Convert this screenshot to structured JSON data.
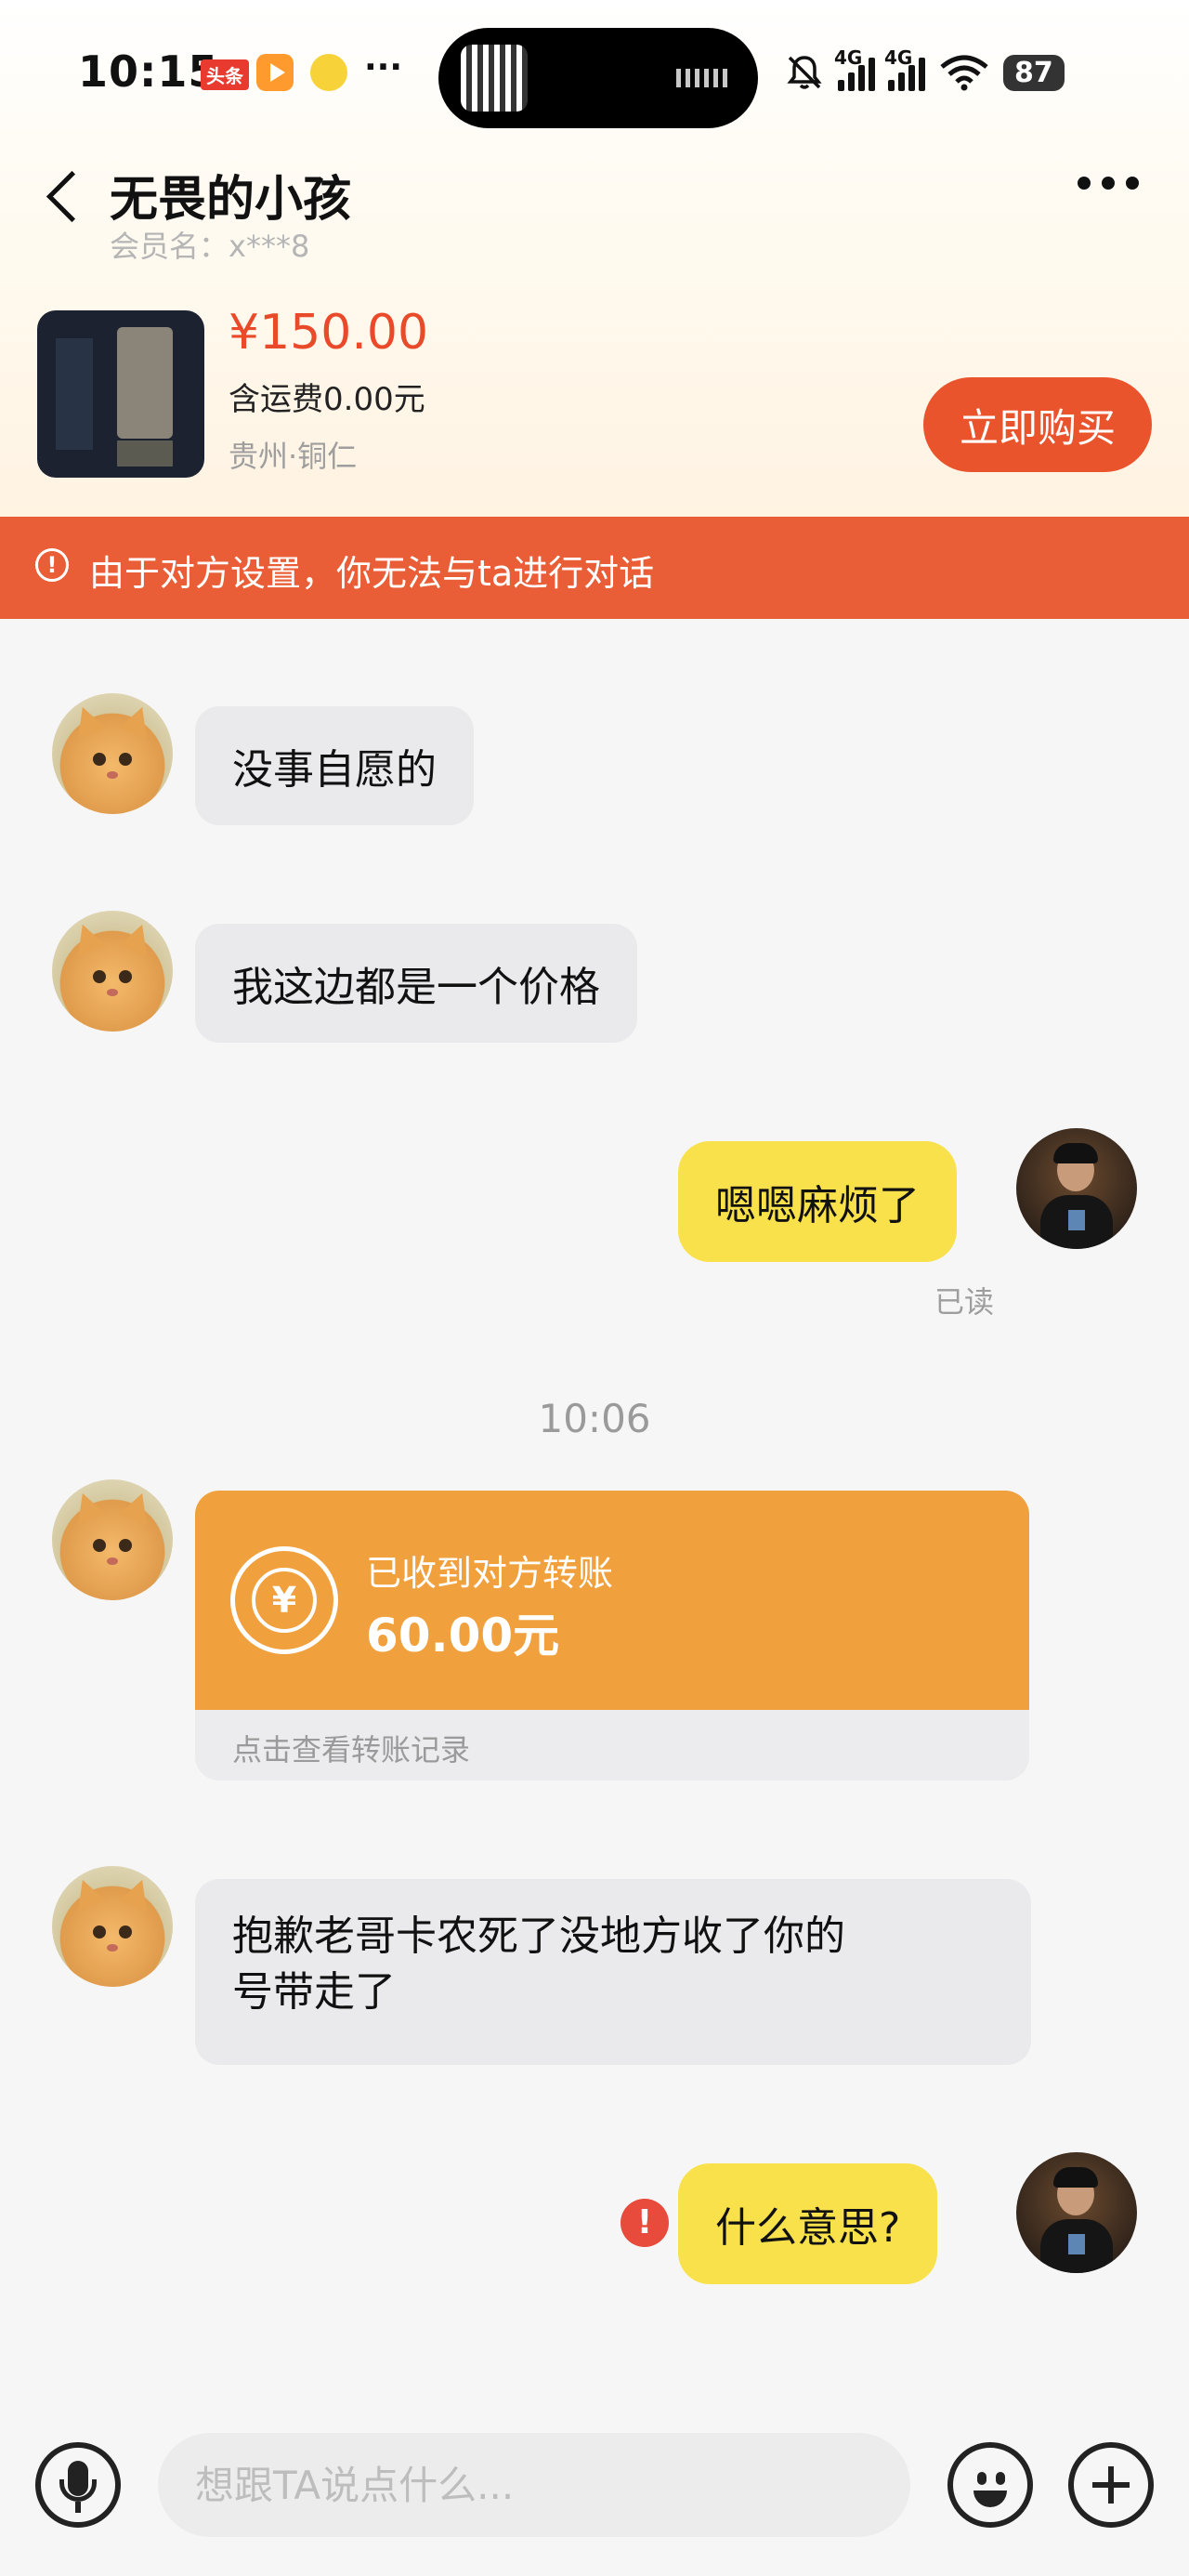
{
  "status_bar": {
    "time": "10:15",
    "app_badge": "头条",
    "more": "···",
    "signal1": "4G",
    "signal2": "4G",
    "battery": "87"
  },
  "header": {
    "title": "无畏的小孩",
    "member": "会员名：x***8"
  },
  "product": {
    "price": "¥150.00",
    "shipping": "含运费0.00元",
    "location": "贵州·铜仁",
    "buy_label": "立即购买"
  },
  "banner": {
    "icon": "!",
    "text": "由于对方设置，你无法与ta进行对话"
  },
  "messages": {
    "m1": "没事自愿的",
    "m2": "我这边都是一个价格",
    "m3": "嗯嗯麻烦了",
    "m3_status": "已读",
    "time_divider": "10:06",
    "transfer": {
      "title": "已收到对方转账",
      "amount": "60.00元",
      "footer": "点击查看转账记录",
      "icon": "¥"
    },
    "m4_line1": "抱歉老哥卡农死了没地方收了你的",
    "m4_line2": "号带走了",
    "m5": "什么意思?",
    "m5_error": "!"
  },
  "input": {
    "placeholder": "想跟TA说点什么..."
  },
  "colors": {
    "accent": "#e9542d",
    "banner": "#e95e37",
    "outgoing_bubble": "#f8e14a",
    "transfer": "#f0a03c"
  }
}
